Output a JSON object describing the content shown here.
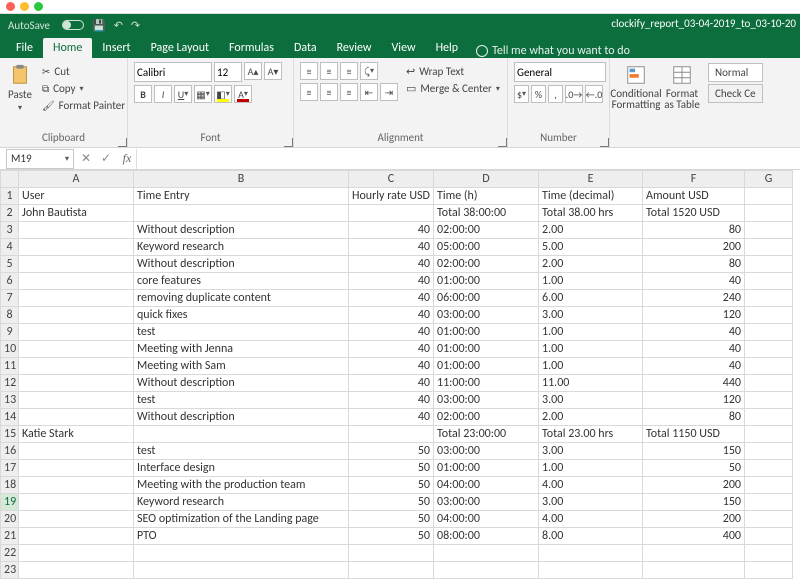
{
  "window": {
    "filename": "clockify_report_03-04-2019_to_03-10-20"
  },
  "qat": {
    "autosave_label": "AutoSave"
  },
  "tabs": {
    "file": "File",
    "home": "Home",
    "insert": "Insert",
    "page_layout": "Page Layout",
    "formulas": "Formulas",
    "data": "Data",
    "review": "Review",
    "view": "View",
    "help": "Help",
    "tell_me": "Tell me what you want to do"
  },
  "ribbon": {
    "clipboard": {
      "label": "Clipboard",
      "paste": "Paste",
      "cut": "Cut",
      "copy": "Copy",
      "format_painter": "Format Painter"
    },
    "font": {
      "label": "Font",
      "name": "Calibri",
      "size": "12"
    },
    "alignment": {
      "label": "Alignment",
      "wrap": "Wrap Text",
      "merge": "Merge & Center"
    },
    "number": {
      "label": "Number",
      "format": "General"
    },
    "styles": {
      "conditional": "Conditional Formatting",
      "table": "Format as Table",
      "normal": "Normal",
      "check": "Check Ce"
    }
  },
  "formula_bar": {
    "cell_ref": "M19",
    "fx": "fx"
  },
  "columns": [
    "A",
    "B",
    "C",
    "D",
    "E",
    "F",
    "G"
  ],
  "rows": [
    {
      "n": 1,
      "A": "User",
      "B": "Time Entry",
      "C": "Hourly rate USD",
      "D": "Time (h)",
      "E": "Time (decimal)",
      "F": "Amount USD",
      "align": {
        "C": "text",
        "D": "text",
        "E": "text",
        "F": "text"
      }
    },
    {
      "n": 2,
      "A": "John Bautista",
      "B": "",
      "C": "",
      "D": "Total 38:00:00",
      "E": "Total 38.00 hrs",
      "F": "Total  1520 USD",
      "align": {
        "D": "text",
        "E": "text",
        "F": "text"
      }
    },
    {
      "n": 3,
      "A": "",
      "B": "Without description",
      "C": "40",
      "D": "02:00:00",
      "E": "2.00",
      "F": "80",
      "align": {
        "C": "num",
        "D": "text",
        "E": "text",
        "F": "num"
      }
    },
    {
      "n": 4,
      "A": "",
      "B": "Keyword research",
      "C": "40",
      "D": "05:00:00",
      "E": "5.00",
      "F": "200",
      "align": {
        "C": "num",
        "D": "text",
        "E": "text",
        "F": "num"
      }
    },
    {
      "n": 5,
      "A": "",
      "B": "Without description",
      "C": "40",
      "D": "02:00:00",
      "E": "2.00",
      "F": "80",
      "align": {
        "C": "num",
        "D": "text",
        "E": "text",
        "F": "num"
      }
    },
    {
      "n": 6,
      "A": "",
      "B": "core features",
      "C": "40",
      "D": "01:00:00",
      "E": "1.00",
      "F": "40",
      "align": {
        "C": "num",
        "D": "text",
        "E": "text",
        "F": "num"
      }
    },
    {
      "n": 7,
      "A": "",
      "B": "removing duplicate content",
      "C": "40",
      "D": "06:00:00",
      "E": "6.00",
      "F": "240",
      "align": {
        "C": "num",
        "D": "text",
        "E": "text",
        "F": "num"
      }
    },
    {
      "n": 8,
      "A": "",
      "B": "quick fixes",
      "C": "40",
      "D": "03:00:00",
      "E": "3.00",
      "F": "120",
      "align": {
        "C": "num",
        "D": "text",
        "E": "text",
        "F": "num"
      }
    },
    {
      "n": 9,
      "A": "",
      "B": "test",
      "C": "40",
      "D": "01:00:00",
      "E": "1.00",
      "F": "40",
      "align": {
        "C": "num",
        "D": "text",
        "E": "text",
        "F": "num"
      }
    },
    {
      "n": 10,
      "A": "",
      "B": "Meeting with Jenna",
      "C": "40",
      "D": "01:00:00",
      "E": "1.00",
      "F": "40",
      "align": {
        "C": "num",
        "D": "text",
        "E": "text",
        "F": "num"
      }
    },
    {
      "n": 11,
      "A": "",
      "B": "Meeting with Sam",
      "C": "40",
      "D": "01:00:00",
      "E": "1.00",
      "F": "40",
      "align": {
        "C": "num",
        "D": "text",
        "E": "text",
        "F": "num"
      }
    },
    {
      "n": 12,
      "A": "",
      "B": "Without description",
      "C": "40",
      "D": "11:00:00",
      "E": "11.00",
      "F": "440",
      "align": {
        "C": "num",
        "D": "text",
        "E": "text",
        "F": "num"
      }
    },
    {
      "n": 13,
      "A": "",
      "B": "test",
      "C": "40",
      "D": "03:00:00",
      "E": "3.00",
      "F": "120",
      "align": {
        "C": "num",
        "D": "text",
        "E": "text",
        "F": "num"
      }
    },
    {
      "n": 14,
      "A": "",
      "B": "Without description",
      "C": "40",
      "D": "02:00:00",
      "E": "2.00",
      "F": "80",
      "align": {
        "C": "num",
        "D": "text",
        "E": "text",
        "F": "num"
      }
    },
    {
      "n": 15,
      "A": "Katie Stark",
      "B": "",
      "C": "",
      "D": "Total 23:00:00",
      "E": "Total 23.00 hrs",
      "F": "Total  1150 USD",
      "align": {
        "D": "text",
        "E": "text",
        "F": "text"
      }
    },
    {
      "n": 16,
      "A": "",
      "B": "test",
      "C": "50",
      "D": "03:00:00",
      "E": "3.00",
      "F": "150",
      "align": {
        "C": "num",
        "D": "text",
        "E": "text",
        "F": "num"
      }
    },
    {
      "n": 17,
      "A": "",
      "B": "Interface design",
      "C": "50",
      "D": "01:00:00",
      "E": "1.00",
      "F": "50",
      "align": {
        "C": "num",
        "D": "text",
        "E": "text",
        "F": "num"
      }
    },
    {
      "n": 18,
      "A": "",
      "B": "Meeting with the production team",
      "C": "50",
      "D": "04:00:00",
      "E": "4.00",
      "F": "200",
      "align": {
        "C": "num",
        "D": "text",
        "E": "text",
        "F": "num"
      }
    },
    {
      "n": 19,
      "A": "",
      "B": "Keyword research",
      "C": "50",
      "D": "03:00:00",
      "E": "3.00",
      "F": "150",
      "align": {
        "C": "num",
        "D": "text",
        "E": "text",
        "F": "num"
      },
      "selected": true
    },
    {
      "n": 20,
      "A": "",
      "B": "SEO optimization of the Landing page",
      "C": "50",
      "D": "04:00:00",
      "E": "4.00",
      "F": "200",
      "align": {
        "C": "num",
        "D": "text",
        "E": "text",
        "F": "num"
      }
    },
    {
      "n": 21,
      "A": "",
      "B": "PTO",
      "C": "50",
      "D": "08:00:00",
      "E": "8.00",
      "F": "400",
      "align": {
        "C": "num",
        "D": "text",
        "E": "text",
        "F": "num"
      }
    },
    {
      "n": 22,
      "A": "",
      "B": "",
      "C": "",
      "D": "",
      "E": "",
      "F": ""
    },
    {
      "n": 23,
      "A": "",
      "B": "",
      "C": "",
      "D": "",
      "E": "",
      "F": ""
    }
  ]
}
